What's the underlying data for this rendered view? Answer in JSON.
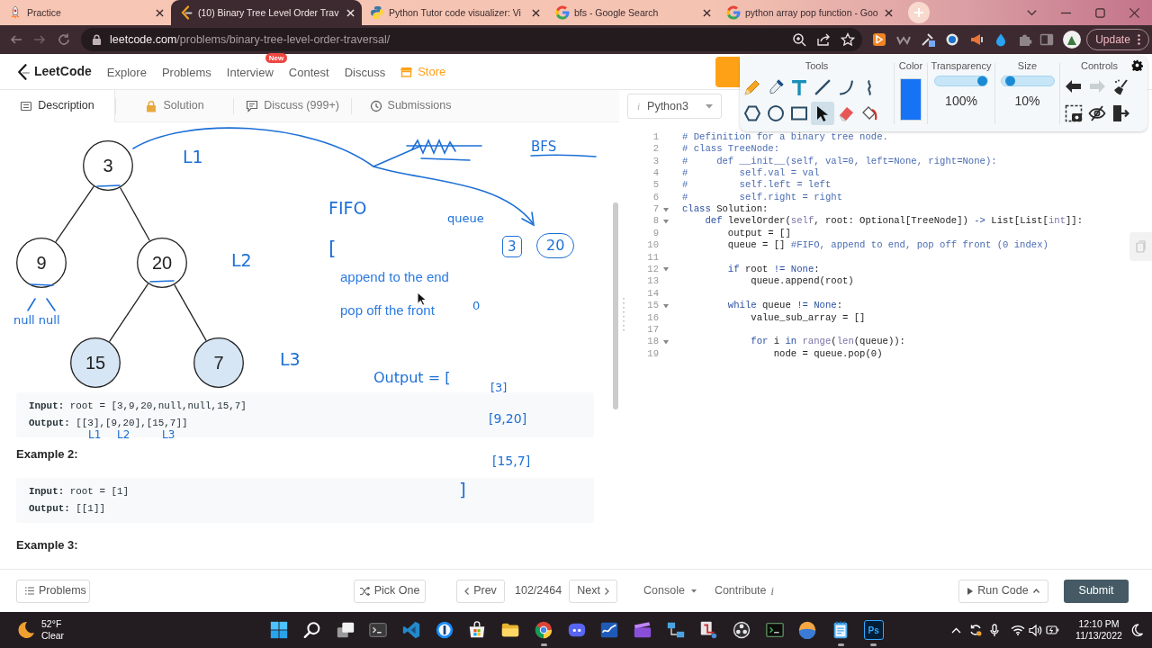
{
  "browser": {
    "tabs": [
      {
        "title": "Practice",
        "kind": "rocket",
        "selected": false
      },
      {
        "title": "(10) Binary Tree Level Order Trav",
        "kind": "leetcode",
        "selected": true
      },
      {
        "title": "Python Tutor code visualizer: Vi",
        "kind": "python",
        "selected": false
      },
      {
        "title": "bfs - Google Search",
        "kind": "google",
        "selected": false
      },
      {
        "title": "python array pop function - Goo",
        "kind": "google",
        "selected": false
      }
    ],
    "url": {
      "host": "leetcode.com",
      "path": "/problems/binary-tree-level-order-traversal/"
    },
    "update_button": "Update"
  },
  "site_nav": {
    "brand": "LeetCode",
    "links": [
      {
        "label": "Explore",
        "kind": "link"
      },
      {
        "label": "Problems",
        "kind": "link"
      },
      {
        "label": "Interview",
        "kind": "link",
        "badge": "New"
      },
      {
        "label": "Contest",
        "kind": "link"
      },
      {
        "label": "Discuss",
        "kind": "link"
      },
      {
        "label": "Store",
        "kind": "store"
      }
    ]
  },
  "panel_tabs": [
    {
      "label": "Description",
      "kind": "description",
      "selected": true
    },
    {
      "label": "Solution",
      "kind": "lock",
      "selected": false
    },
    {
      "label": "Discuss (999+)",
      "kind": "discuss",
      "selected": false
    },
    {
      "label": "Submissions",
      "kind": "clock",
      "selected": false
    }
  ],
  "tree": {
    "value": "3",
    "highlighted": false,
    "children": [
      {
        "value": "9",
        "highlighted": false
      },
      {
        "value": "20",
        "highlighted": false,
        "children": [
          {
            "value": "15",
            "highlighted": true
          },
          {
            "value": "7",
            "highlighted": true
          }
        ]
      }
    ]
  },
  "examples": [
    {
      "lines": [
        "**Input:** root = [3,9,20,null,null,15,7]",
        "**Output:** [[3],[9,20],[15,7]]"
      ]
    },
    {
      "title": "Example 2:",
      "lines": [
        "**Input:** root = [1]",
        "**Output:** [[1]]"
      ]
    },
    {
      "title": "Example 3:"
    }
  ],
  "annotations": [
    {
      "kind": "handwriting",
      "text": "L1"
    },
    {
      "kind": "handwriting",
      "text": "BFS"
    },
    {
      "kind": "handwriting",
      "text": "FIFO"
    },
    {
      "kind": "handwriting",
      "text": "queue"
    },
    {
      "kind": "handwriting",
      "text": "L2"
    },
    {
      "kind": "handwriting",
      "text": "["
    },
    {
      "kind": "boxed",
      "text": "3"
    },
    {
      "kind": "circled",
      "text": "20"
    },
    {
      "kind": "typed",
      "text": "append to the end"
    },
    {
      "kind": "handwriting",
      "text": "null null"
    },
    {
      "kind": "typed",
      "text": "pop off the front"
    },
    {
      "kind": "handwriting",
      "text": "0"
    },
    {
      "kind": "handwriting",
      "text": "L3"
    },
    {
      "kind": "handwriting",
      "text": "Output = ["
    },
    {
      "kind": "handwriting",
      "text": "[3]"
    },
    {
      "kind": "handwriting",
      "text": "[9,20]"
    },
    {
      "kind": "handwriting",
      "text": "L1"
    },
    {
      "kind": "handwriting",
      "text": "L2"
    },
    {
      "kind": "handwriting",
      "text": "L3"
    },
    {
      "kind": "handwriting",
      "text": "[15,7]"
    },
    {
      "kind": "handwriting",
      "text": "]"
    }
  ],
  "editor": {
    "language": "Python3",
    "language_mark": "i",
    "lines": [
      {
        "number": "1",
        "foldable": false,
        "tokens": [
          {
            "kind": "comment",
            "text": "# Definition for a binary tree node."
          }
        ]
      },
      {
        "number": "2",
        "foldable": false,
        "tokens": [
          {
            "kind": "comment",
            "text": "# class TreeNode:"
          }
        ]
      },
      {
        "number": "3",
        "foldable": false,
        "tokens": [
          {
            "kind": "comment",
            "text": "#     def __init__(self, val=0, left=None, right=None):"
          }
        ]
      },
      {
        "number": "4",
        "foldable": false,
        "tokens": [
          {
            "kind": "comment",
            "text": "#         self.val = val"
          }
        ]
      },
      {
        "number": "5",
        "foldable": false,
        "tokens": [
          {
            "kind": "comment",
            "text": "#         self.left = left"
          }
        ]
      },
      {
        "number": "6",
        "foldable": false,
        "tokens": [
          {
            "kind": "comment",
            "text": "#         self.right = right"
          }
        ]
      },
      {
        "number": "7",
        "foldable": true,
        "tokens": [
          {
            "kind": "keyword",
            "text": "class"
          },
          {
            "kind": "plain",
            "text": " Solution:"
          }
        ]
      },
      {
        "number": "8",
        "foldable": true,
        "tokens": [
          {
            "kind": "keyword",
            "text": "    def"
          },
          {
            "kind": "plain",
            "text": " levelOrder("
          },
          {
            "kind": "builtin",
            "text": "self"
          },
          {
            "kind": "plain",
            "text": ", root: Optional[TreeNode]) "
          },
          {
            "kind": "keyword",
            "text": "->"
          },
          {
            "kind": "plain",
            "text": " List[List["
          },
          {
            "kind": "builtin",
            "text": "int"
          },
          {
            "kind": "plain",
            "text": "]]:"
          }
        ]
      },
      {
        "number": "9",
        "foldable": false,
        "tokens": [
          {
            "kind": "plain",
            "text": "        output = []"
          }
        ]
      },
      {
        "number": "10",
        "foldable": false,
        "tokens": [
          {
            "kind": "plain",
            "text": "        queue = [] "
          },
          {
            "kind": "comment",
            "text": "#FIFO, append to end, pop off front (0 index)"
          }
        ]
      },
      {
        "number": "11",
        "foldable": false
      },
      {
        "number": "12",
        "foldable": true,
        "tokens": [
          {
            "kind": "keyword",
            "text": "        if"
          },
          {
            "kind": "plain",
            "text": " root "
          },
          {
            "kind": "keyword",
            "text": "!= None"
          },
          {
            "kind": "plain",
            "text": ":"
          }
        ]
      },
      {
        "number": "13",
        "foldable": false,
        "tokens": [
          {
            "kind": "plain",
            "text": "            queue.append(root)"
          }
        ]
      },
      {
        "number": "14",
        "foldable": false
      },
      {
        "number": "15",
        "foldable": true,
        "tokens": [
          {
            "kind": "keyword",
            "text": "        while"
          },
          {
            "kind": "plain",
            "text": " queue "
          },
          {
            "kind": "keyword",
            "text": "!= None"
          },
          {
            "kind": "plain",
            "text": ":"
          }
        ]
      },
      {
        "number": "16",
        "foldable": false,
        "tokens": [
          {
            "kind": "plain",
            "text": "            value_sub_array = []"
          }
        ]
      },
      {
        "number": "17",
        "foldable": false
      },
      {
        "number": "18",
        "foldable": true,
        "tokens": [
          {
            "kind": "keyword",
            "text": "            for"
          },
          {
            "kind": "plain",
            "text": " i "
          },
          {
            "kind": "keyword",
            "text": "in "
          },
          {
            "kind": "builtin",
            "text": "range"
          },
          {
            "kind": "plain",
            "text": "("
          },
          {
            "kind": "builtin",
            "text": "len"
          },
          {
            "kind": "plain",
            "text": "(queue)):"
          }
        ]
      },
      {
        "number": "19",
        "foldable": false,
        "tokens": [
          {
            "kind": "plain",
            "text": "                node = queue.pop(0)"
          }
        ]
      }
    ]
  },
  "annotation_toolbar": {
    "tools_title": "Tools",
    "tools": [
      {
        "kind": "pencil",
        "selected": false
      },
      {
        "kind": "dropper",
        "selected": false
      },
      {
        "kind": "text",
        "selected": false
      },
      {
        "kind": "line",
        "selected": false
      },
      {
        "kind": "curve",
        "selected": false
      },
      {
        "kind": "wave",
        "selected": false
      },
      {
        "kind": "polygon",
        "selected": false
      },
      {
        "kind": "circle",
        "selected": false
      },
      {
        "kind": "rectangle",
        "selected": false
      },
      {
        "kind": "pointer",
        "selected": true
      },
      {
        "kind": "eraser",
        "selected": false
      },
      {
        "kind": "fill",
        "selected": false
      }
    ],
    "color_picker": {
      "title": "Color",
      "color": "#1673f5"
    },
    "transparency": {
      "title": "Transparency",
      "level": 1,
      "reading": "100%"
    },
    "size": {
      "title": "Size",
      "level": 0.1,
      "reading": "10%"
    },
    "controls_title": "Controls",
    "controls": [
      {
        "kind": "undo",
        "disabled": false
      },
      {
        "kind": "redo",
        "disabled": true
      },
      {
        "kind": "clear",
        "disabled": false
      },
      {
        "kind": "capture",
        "disabled": false
      },
      {
        "kind": "hide",
        "disabled": false
      },
      {
        "kind": "exit",
        "disabled": false
      }
    ]
  },
  "footer": {
    "problems": "Problems",
    "pick_one": "Pick One",
    "prev": "Prev",
    "counter": "102/2464",
    "next": "Next",
    "console": "Console",
    "contribute": "Contribute",
    "contribute_mark": "i",
    "run_code": "Run Code",
    "submit": "Submit"
  },
  "taskbar": {
    "weather": {
      "temperature": "52°F",
      "condition": "Clear"
    },
    "apps": [
      {
        "kind": "start",
        "running": false
      },
      {
        "kind": "search",
        "running": false
      },
      {
        "kind": "taskview",
        "running": false
      },
      {
        "kind": "terminal",
        "running": false
      },
      {
        "kind": "vscode",
        "running": false
      },
      {
        "kind": "password",
        "running": false
      },
      {
        "kind": "store",
        "running": false
      },
      {
        "kind": "files",
        "running": false
      },
      {
        "kind": "chrome",
        "running": true
      },
      {
        "kind": "discord",
        "running": false
      },
      {
        "kind": "chart",
        "running": false
      },
      {
        "kind": "clapboard",
        "running": false
      },
      {
        "kind": "network",
        "running": false
      },
      {
        "kind": "tool",
        "running": false
      },
      {
        "kind": "obs",
        "running": false
      },
      {
        "kind": "console",
        "running": false
      },
      {
        "kind": "orb",
        "running": false
      },
      {
        "kind": "notepad",
        "running": true
      },
      {
        "kind": "tile",
        "label": "Ps",
        "running": true
      }
    ],
    "clock": {
      "time": "12:10 PM",
      "date": "11/13/2022"
    }
  }
}
